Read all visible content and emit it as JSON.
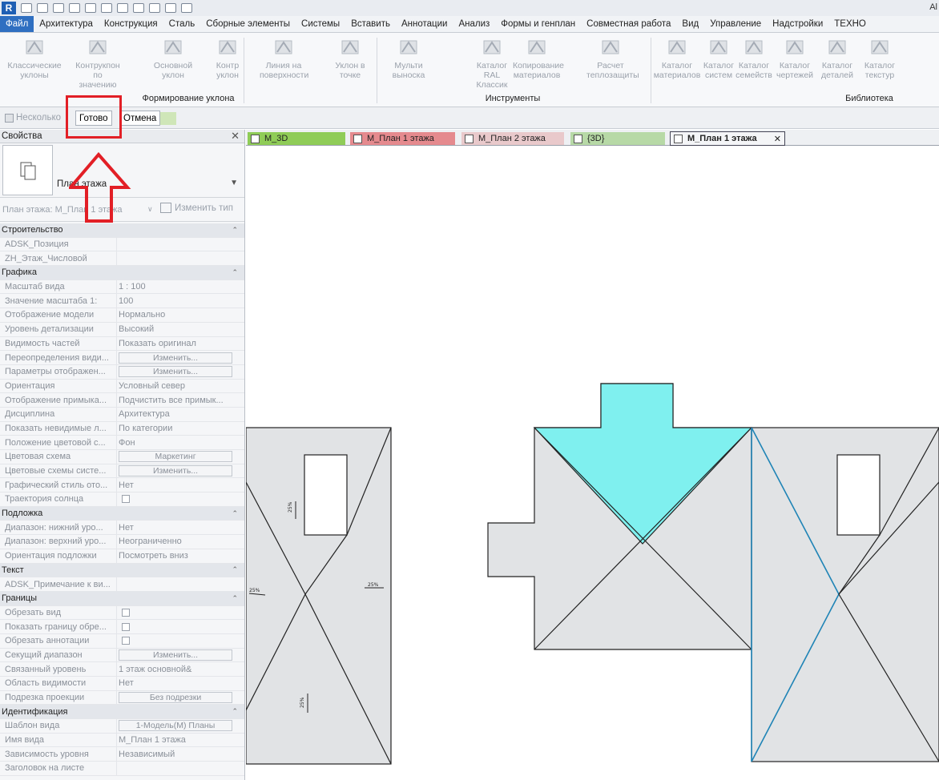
{
  "qat": {
    "user": "Al"
  },
  "tabs": [
    "Файл",
    "Архитектура",
    "Конструкция",
    "Сталь",
    "Сборные элементы",
    "Системы",
    "Вставить",
    "Аннотации",
    "Анализ",
    "Формы и генплан",
    "Совместная работа",
    "Вид",
    "Управление",
    "Надстройки",
    "ТЕХНО"
  ],
  "ribbon": {
    "buttons": [
      {
        "l1": "Классические",
        "l2": "уклоны"
      },
      {
        "l1": "Контрукпон",
        "l2": "по значению"
      },
      {
        "l1": "Основной",
        "l2": "уклон"
      },
      {
        "l1": "Контр",
        "l2": "уклон"
      },
      {
        "l1": "Линия на",
        "l2": "поверхности"
      },
      {
        "l1": "Уклон в",
        "l2": "точке"
      },
      {
        "l1": "Мульти",
        "l2": "выноска"
      },
      {
        "l1": "Каталог",
        "l2": "RAL Классик"
      },
      {
        "l1": "Копирование",
        "l2": "материалов"
      },
      {
        "l1": "Расчет",
        "l2": "теплозащиты"
      },
      {
        "l1": "Каталог",
        "l2": "материалов"
      },
      {
        "l1": "Каталог",
        "l2": "систем"
      },
      {
        "l1": "Каталог",
        "l2": "семейств"
      },
      {
        "l1": "Каталог",
        "l2": "чертежей"
      },
      {
        "l1": "Каталог",
        "l2": "деталей"
      },
      {
        "l1": "Каталог",
        "l2": "текстур"
      }
    ],
    "groups": [
      "Формирование уклона",
      "Инструменты",
      "Библиотека"
    ]
  },
  "options": {
    "multiple": "Несколько",
    "finish": "Готово",
    "cancel": "Отмена"
  },
  "props": {
    "title": "Свойства",
    "type_name": "План этажа",
    "instance": "План этажа: М_План 1 этажа",
    "edit_type": "Изменить тип",
    "rows": [
      {
        "cat": "Строительство"
      },
      {
        "k": "ADSK_Позиция",
        "v": ""
      },
      {
        "k": "ZH_Этаж_Числовой",
        "v": ""
      },
      {
        "cat": "Графика"
      },
      {
        "k": "Масштаб вида",
        "v": "1 : 100"
      },
      {
        "k": "Значение масштаба   1:",
        "v": "100"
      },
      {
        "k": "Отображение модели",
        "v": "Нормально"
      },
      {
        "k": "Уровень детализации",
        "v": "Высокий"
      },
      {
        "k": "Видимость частей",
        "v": "Показать оригинал"
      },
      {
        "k": "Переопределения види...",
        "btn": "Изменить..."
      },
      {
        "k": "Параметры отображен...",
        "btn": "Изменить..."
      },
      {
        "k": "Ориентация",
        "v": "Условный север"
      },
      {
        "k": "Отображение примыка...",
        "v": "Подчистить все примык..."
      },
      {
        "k": "Дисциплина",
        "v": "Архитектура"
      },
      {
        "k": "Показать невидимые л...",
        "v": "По категории"
      },
      {
        "k": "Положение цветовой с...",
        "v": "Фон"
      },
      {
        "k": "Цветовая схема",
        "btn": "Маркетинг"
      },
      {
        "k": "Цветовые схемы систе...",
        "btn": "Изменить..."
      },
      {
        "k": "Графический стиль ото...",
        "v": "Нет"
      },
      {
        "k": "Траектория солнца",
        "chk": true
      },
      {
        "cat": "Подложка"
      },
      {
        "k": "Диапазон: нижний уро...",
        "v": "Нет"
      },
      {
        "k": "Диапазон: верхний уро...",
        "v": "Неограниченно"
      },
      {
        "k": "Ориентация подложки",
        "v": "Посмотреть вниз"
      },
      {
        "cat": "Текст"
      },
      {
        "k": "ADSK_Примечание к ви...",
        "v": ""
      },
      {
        "cat": "Границы"
      },
      {
        "k": "Обрезать вид",
        "chk": true
      },
      {
        "k": "Показать границу обре...",
        "chk": true
      },
      {
        "k": "Обрезать аннотации",
        "chk": true
      },
      {
        "k": "Секущий диапазон",
        "btn": "Изменить..."
      },
      {
        "k": "Связанный уровень",
        "v": "1 этаж основной&"
      },
      {
        "k": "Область видимости",
        "v": "Нет"
      },
      {
        "k": "Подрезка проекции",
        "btn": "Без подрезки"
      },
      {
        "cat": "Идентификация"
      },
      {
        "k": "Шаблон вида",
        "btn": "1-Модель(М) Планы"
      },
      {
        "k": "Имя вида",
        "v": "М_План 1 этажа"
      },
      {
        "k": "Зависимость уровня",
        "v": "Независимый"
      },
      {
        "k": "Заголовок на листе",
        "v": ""
      }
    ]
  },
  "viewtabs": [
    {
      "label": "М_3D",
      "color": "#8fcc57"
    },
    {
      "label": "М_План 1 этажа",
      "color": "#e58a8e"
    },
    {
      "label": "М_План 2 этажа",
      "color": "#e9c9cb"
    },
    {
      "label": "{3D}",
      "color": "#b7d9a6"
    },
    {
      "label": "М_План 1 этажа",
      "color": "#f4f5f7"
    }
  ],
  "colors": {
    "accent": "#2f6fc1",
    "highlight": "#e21f26",
    "roof_fill": "#e1e3e5",
    "selected_face": "#7ff0ef",
    "slope_line": "#1f84b6"
  }
}
